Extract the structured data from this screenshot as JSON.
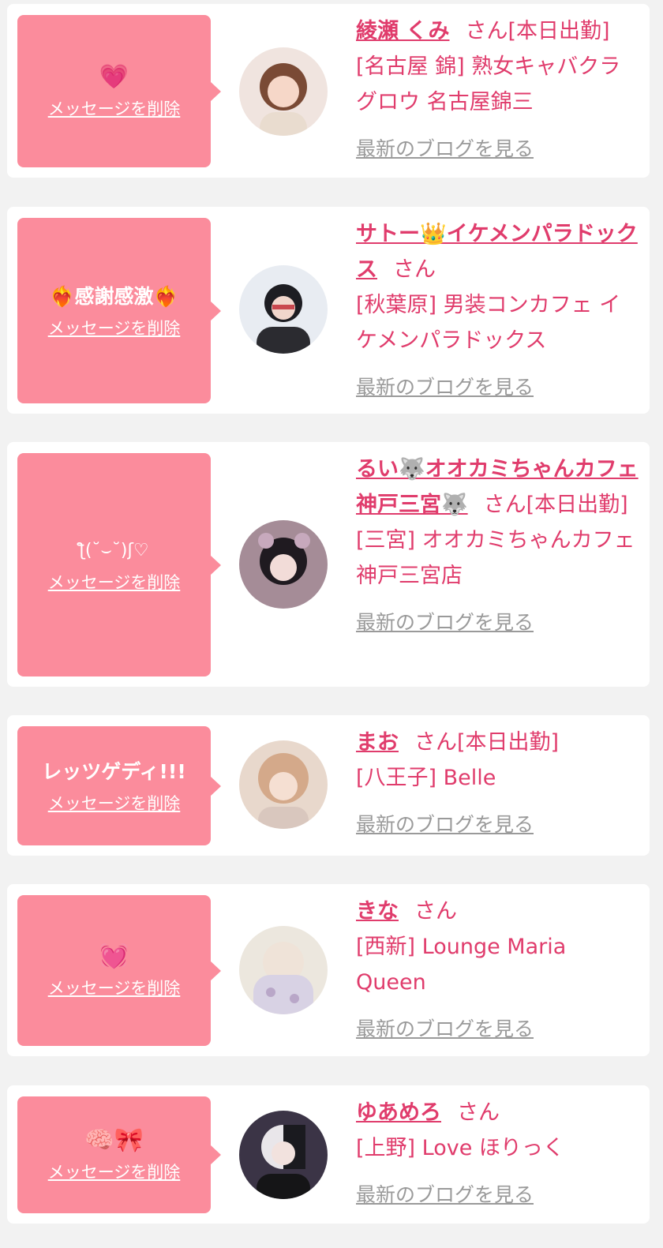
{
  "colors": {
    "page_bg": "#f2f2f2",
    "bubble_pink": "#fb8c9c",
    "name_pink": "#e03c6c",
    "link_gray": "#9a9a9a"
  },
  "delete_label": "メッセージを削除",
  "blog_label": "最新のブログを見る",
  "san_label": "さん",
  "items": [
    {
      "message": "💗",
      "name": "綾瀬 くみ",
      "suffix": "[本日出勤]",
      "shop": "[名古屋 錦] 熟女キャバクラグロウ 名古屋錦三"
    },
    {
      "message": "❤️‍🔥感謝感激❤️‍🔥",
      "name": "サトー👑イケメンパラドックス",
      "suffix": "",
      "shop": "[秋葉原] 男装コンカフェ イケメンパラドックス"
    },
    {
      "message": "ƪ(˘⌣˘)ʃ♡",
      "name": "るい🐺オオカミちゃんカフェ神戸三宮🐺",
      "suffix": "[本日出勤]",
      "shop": "[三宮] オオカミちゃんカフェ神戸三宮店"
    },
    {
      "message": "レッツゲディ!!!",
      "name": "まお",
      "suffix": "[本日出勤]",
      "shop": "[八王子] Belle"
    },
    {
      "message": "💓",
      "name": "きな",
      "suffix": "",
      "shop": "[西新] Lounge Maria Queen"
    },
    {
      "message": "🧠🎀",
      "name": "ゆあめろ",
      "suffix": "",
      "shop": "[上野] Love ほりっく"
    }
  ]
}
